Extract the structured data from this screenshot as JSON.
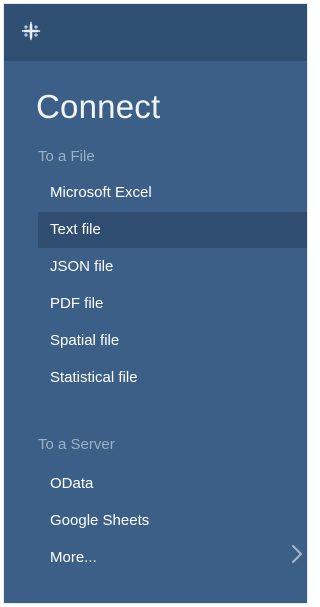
{
  "panel": {
    "logo_icon": "tableau-logo-icon",
    "title": "Connect"
  },
  "file_section": {
    "label": "To a File",
    "items": [
      {
        "label": "Microsoft Excel"
      },
      {
        "label": "Text file",
        "selected": true
      },
      {
        "label": "JSON file"
      },
      {
        "label": "PDF file"
      },
      {
        "label": "Spatial file"
      },
      {
        "label": "Statistical file"
      }
    ]
  },
  "server_section": {
    "label": "To a Server",
    "items": [
      {
        "label": "OData"
      },
      {
        "label": "Google Sheets"
      },
      {
        "label": "More..."
      }
    ],
    "more_icon": "chevron-right-icon"
  },
  "colors": {
    "panel_background": "#3b5f86",
    "topbar_background": "#2f4f73",
    "selected_item_background": "#2e4d70",
    "section_label": "#9db1c6",
    "item_text": "#ffffff"
  }
}
